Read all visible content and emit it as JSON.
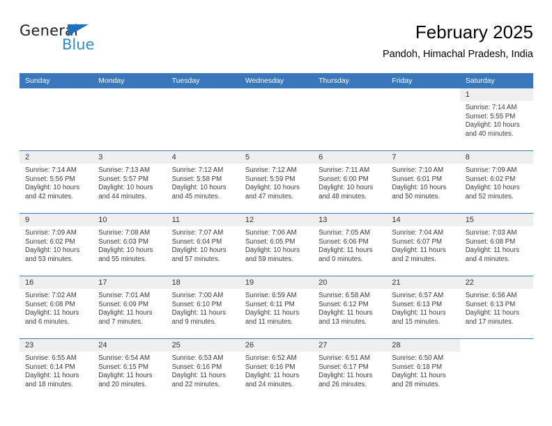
{
  "brand": {
    "name_top": "General",
    "name_bottom": "Blue",
    "triangle_color": "#1f6fc0",
    "blue_text_color": "#2e8bd0"
  },
  "header": {
    "title": "February 2025",
    "subtitle": "Pandoh, Himachal Pradesh, India"
  },
  "theme": {
    "header_blue": "#3a77bd",
    "day_band_gray": "#efefef",
    "text_color": "#3a3a3a"
  },
  "weekdays": [
    "Sunday",
    "Monday",
    "Tuesday",
    "Wednesday",
    "Thursday",
    "Friday",
    "Saturday"
  ],
  "weeks": [
    [
      {
        "day": "",
        "sunrise": "",
        "sunset": "",
        "daylight": "",
        "blank": true
      },
      {
        "day": "",
        "sunrise": "",
        "sunset": "",
        "daylight": "",
        "blank": true
      },
      {
        "day": "",
        "sunrise": "",
        "sunset": "",
        "daylight": "",
        "blank": true
      },
      {
        "day": "",
        "sunrise": "",
        "sunset": "",
        "daylight": "",
        "blank": true
      },
      {
        "day": "",
        "sunrise": "",
        "sunset": "",
        "daylight": "",
        "blank": true
      },
      {
        "day": "",
        "sunrise": "",
        "sunset": "",
        "daylight": "",
        "blank": true
      },
      {
        "day": "1",
        "sunrise": "Sunrise: 7:14 AM",
        "sunset": "Sunset: 5:55 PM",
        "daylight": "Daylight: 10 hours and 40 minutes."
      }
    ],
    [
      {
        "day": "2",
        "sunrise": "Sunrise: 7:14 AM",
        "sunset": "Sunset: 5:56 PM",
        "daylight": "Daylight: 10 hours and 42 minutes."
      },
      {
        "day": "3",
        "sunrise": "Sunrise: 7:13 AM",
        "sunset": "Sunset: 5:57 PM",
        "daylight": "Daylight: 10 hours and 44 minutes."
      },
      {
        "day": "4",
        "sunrise": "Sunrise: 7:12 AM",
        "sunset": "Sunset: 5:58 PM",
        "daylight": "Daylight: 10 hours and 45 minutes."
      },
      {
        "day": "5",
        "sunrise": "Sunrise: 7:12 AM",
        "sunset": "Sunset: 5:59 PM",
        "daylight": "Daylight: 10 hours and 47 minutes."
      },
      {
        "day": "6",
        "sunrise": "Sunrise: 7:11 AM",
        "sunset": "Sunset: 6:00 PM",
        "daylight": "Daylight: 10 hours and 48 minutes."
      },
      {
        "day": "7",
        "sunrise": "Sunrise: 7:10 AM",
        "sunset": "Sunset: 6:01 PM",
        "daylight": "Daylight: 10 hours and 50 minutes."
      },
      {
        "day": "8",
        "sunrise": "Sunrise: 7:09 AM",
        "sunset": "Sunset: 6:02 PM",
        "daylight": "Daylight: 10 hours and 52 minutes."
      }
    ],
    [
      {
        "day": "9",
        "sunrise": "Sunrise: 7:09 AM",
        "sunset": "Sunset: 6:02 PM",
        "daylight": "Daylight: 10 hours and 53 minutes."
      },
      {
        "day": "10",
        "sunrise": "Sunrise: 7:08 AM",
        "sunset": "Sunset: 6:03 PM",
        "daylight": "Daylight: 10 hours and 55 minutes."
      },
      {
        "day": "11",
        "sunrise": "Sunrise: 7:07 AM",
        "sunset": "Sunset: 6:04 PM",
        "daylight": "Daylight: 10 hours and 57 minutes."
      },
      {
        "day": "12",
        "sunrise": "Sunrise: 7:06 AM",
        "sunset": "Sunset: 6:05 PM",
        "daylight": "Daylight: 10 hours and 59 minutes."
      },
      {
        "day": "13",
        "sunrise": "Sunrise: 7:05 AM",
        "sunset": "Sunset: 6:06 PM",
        "daylight": "Daylight: 11 hours and 0 minutes."
      },
      {
        "day": "14",
        "sunrise": "Sunrise: 7:04 AM",
        "sunset": "Sunset: 6:07 PM",
        "daylight": "Daylight: 11 hours and 2 minutes."
      },
      {
        "day": "15",
        "sunrise": "Sunrise: 7:03 AM",
        "sunset": "Sunset: 6:08 PM",
        "daylight": "Daylight: 11 hours and 4 minutes."
      }
    ],
    [
      {
        "day": "16",
        "sunrise": "Sunrise: 7:02 AM",
        "sunset": "Sunset: 6:08 PM",
        "daylight": "Daylight: 11 hours and 6 minutes."
      },
      {
        "day": "17",
        "sunrise": "Sunrise: 7:01 AM",
        "sunset": "Sunset: 6:09 PM",
        "daylight": "Daylight: 11 hours and 7 minutes."
      },
      {
        "day": "18",
        "sunrise": "Sunrise: 7:00 AM",
        "sunset": "Sunset: 6:10 PM",
        "daylight": "Daylight: 11 hours and 9 minutes."
      },
      {
        "day": "19",
        "sunrise": "Sunrise: 6:59 AM",
        "sunset": "Sunset: 6:11 PM",
        "daylight": "Daylight: 11 hours and 11 minutes."
      },
      {
        "day": "20",
        "sunrise": "Sunrise: 6:58 AM",
        "sunset": "Sunset: 6:12 PM",
        "daylight": "Daylight: 11 hours and 13 minutes."
      },
      {
        "day": "21",
        "sunrise": "Sunrise: 6:57 AM",
        "sunset": "Sunset: 6:13 PM",
        "daylight": "Daylight: 11 hours and 15 minutes."
      },
      {
        "day": "22",
        "sunrise": "Sunrise: 6:56 AM",
        "sunset": "Sunset: 6:13 PM",
        "daylight": "Daylight: 11 hours and 17 minutes."
      }
    ],
    [
      {
        "day": "23",
        "sunrise": "Sunrise: 6:55 AM",
        "sunset": "Sunset: 6:14 PM",
        "daylight": "Daylight: 11 hours and 18 minutes."
      },
      {
        "day": "24",
        "sunrise": "Sunrise: 6:54 AM",
        "sunset": "Sunset: 6:15 PM",
        "daylight": "Daylight: 11 hours and 20 minutes."
      },
      {
        "day": "25",
        "sunrise": "Sunrise: 6:53 AM",
        "sunset": "Sunset: 6:16 PM",
        "daylight": "Daylight: 11 hours and 22 minutes."
      },
      {
        "day": "26",
        "sunrise": "Sunrise: 6:52 AM",
        "sunset": "Sunset: 6:16 PM",
        "daylight": "Daylight: 11 hours and 24 minutes."
      },
      {
        "day": "27",
        "sunrise": "Sunrise: 6:51 AM",
        "sunset": "Sunset: 6:17 PM",
        "daylight": "Daylight: 11 hours and 26 minutes."
      },
      {
        "day": "28",
        "sunrise": "Sunrise: 6:50 AM",
        "sunset": "Sunset: 6:18 PM",
        "daylight": "Daylight: 11 hours and 28 minutes."
      },
      {
        "day": "",
        "sunrise": "",
        "sunset": "",
        "daylight": "",
        "blank": true
      }
    ]
  ]
}
